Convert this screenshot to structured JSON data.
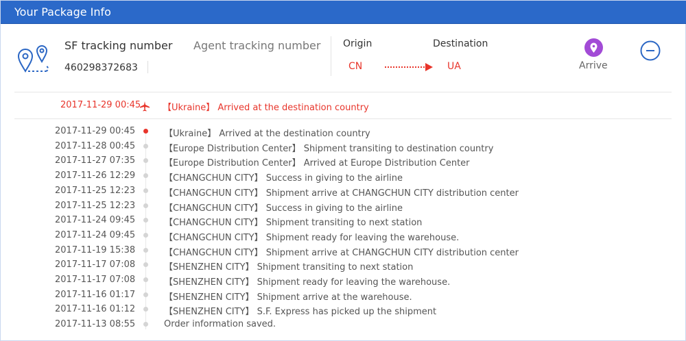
{
  "header": {
    "title": "Your Package Info"
  },
  "package": {
    "sf_label": "SF tracking number",
    "sf_number": "460298372683",
    "agent_label": "Agent tracking number",
    "origin_label": "Origin",
    "destination_label": "Destination",
    "origin_value": "CN",
    "destination_value": "UA",
    "status_label": "Arrive",
    "status_icon": "location-pin-icon",
    "collapse_icon": "minus-circle-icon"
  },
  "colors": {
    "header_bg": "#2b69c9",
    "accent_red": "#e8352b",
    "arrive_purple": "#a24bd6",
    "icon_blue": "#2a66c4"
  },
  "latest": {
    "time": "2017-11-29 00:45",
    "icon": "airplane-icon",
    "desc": "【Ukraine】 Arrived at the destination country"
  },
  "events": [
    {
      "time": "2017-11-29 00:45",
      "desc": "【Ukraine】 Arrived at the destination country",
      "active": true
    },
    {
      "time": "2017-11-28 00:45",
      "desc": "【Europe Distribution Center】 Shipment transiting to destination country"
    },
    {
      "time": "2017-11-27 07:35",
      "desc": "【Europe Distribution Center】 Arrived at Europe Distribution Center"
    },
    {
      "time": "2017-11-26 12:29",
      "desc": "【CHANGCHUN CITY】 Success in giving to the airline"
    },
    {
      "time": "2017-11-25 12:23",
      "desc": "【CHANGCHUN CITY】 Shipment arrive at CHANGCHUN CITY distribution center"
    },
    {
      "time": "2017-11-25 12:23",
      "desc": "【CHANGCHUN CITY】 Success in giving to the airline"
    },
    {
      "time": "2017-11-24 09:45",
      "desc": "【CHANGCHUN CITY】 Shipment transiting to next station"
    },
    {
      "time": "2017-11-24 09:45",
      "desc": "【CHANGCHUN CITY】 Shipment ready for leaving the warehouse."
    },
    {
      "time": "2017-11-19 15:38",
      "desc": "【CHANGCHUN CITY】 Shipment arrive at CHANGCHUN CITY distribution center"
    },
    {
      "time": "2017-11-17 07:08",
      "desc": "【SHENZHEN CITY】 Shipment transiting to next station"
    },
    {
      "time": "2017-11-17 07:08",
      "desc": "【SHENZHEN CITY】 Shipment ready for leaving the warehouse."
    },
    {
      "time": "2017-11-16 01:17",
      "desc": "【SHENZHEN CITY】 Shipment arrive at the warehouse."
    },
    {
      "time": "2017-11-16 01:12",
      "desc": "【SHENZHEN CITY】 S.F. Express has picked up the shipment"
    },
    {
      "time": "2017-11-13 08:55",
      "desc": "Order information saved."
    }
  ]
}
